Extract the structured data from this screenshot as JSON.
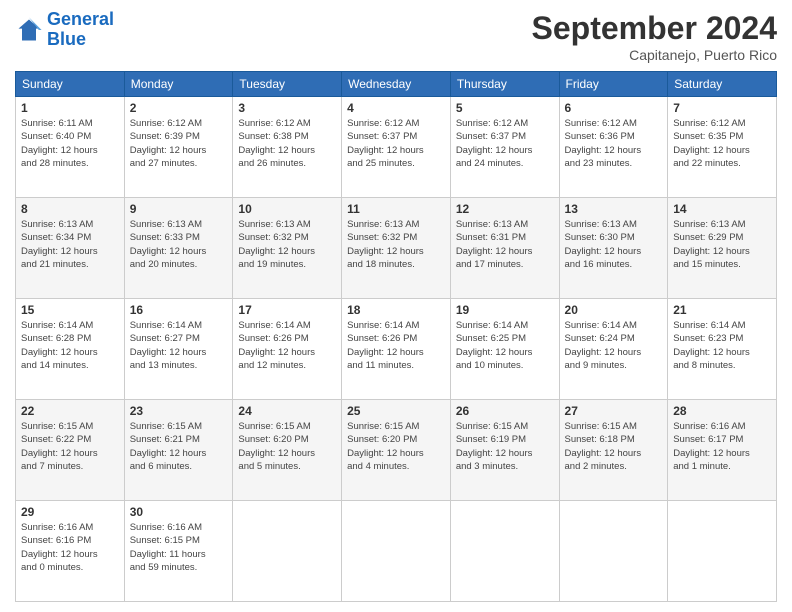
{
  "logo": {
    "line1": "General",
    "line2": "Blue"
  },
  "title": "September 2024",
  "subtitle": "Capitanejo, Puerto Rico",
  "days_header": [
    "Sunday",
    "Monday",
    "Tuesday",
    "Wednesday",
    "Thursday",
    "Friday",
    "Saturday"
  ],
  "weeks": [
    [
      {
        "day": "1",
        "info": "Sunrise: 6:11 AM\nSunset: 6:40 PM\nDaylight: 12 hours\nand 28 minutes."
      },
      {
        "day": "2",
        "info": "Sunrise: 6:12 AM\nSunset: 6:39 PM\nDaylight: 12 hours\nand 27 minutes."
      },
      {
        "day": "3",
        "info": "Sunrise: 6:12 AM\nSunset: 6:38 PM\nDaylight: 12 hours\nand 26 minutes."
      },
      {
        "day": "4",
        "info": "Sunrise: 6:12 AM\nSunset: 6:37 PM\nDaylight: 12 hours\nand 25 minutes."
      },
      {
        "day": "5",
        "info": "Sunrise: 6:12 AM\nSunset: 6:37 PM\nDaylight: 12 hours\nand 24 minutes."
      },
      {
        "day": "6",
        "info": "Sunrise: 6:12 AM\nSunset: 6:36 PM\nDaylight: 12 hours\nand 23 minutes."
      },
      {
        "day": "7",
        "info": "Sunrise: 6:12 AM\nSunset: 6:35 PM\nDaylight: 12 hours\nand 22 minutes."
      }
    ],
    [
      {
        "day": "8",
        "info": "Sunrise: 6:13 AM\nSunset: 6:34 PM\nDaylight: 12 hours\nand 21 minutes."
      },
      {
        "day": "9",
        "info": "Sunrise: 6:13 AM\nSunset: 6:33 PM\nDaylight: 12 hours\nand 20 minutes."
      },
      {
        "day": "10",
        "info": "Sunrise: 6:13 AM\nSunset: 6:32 PM\nDaylight: 12 hours\nand 19 minutes."
      },
      {
        "day": "11",
        "info": "Sunrise: 6:13 AM\nSunset: 6:32 PM\nDaylight: 12 hours\nand 18 minutes."
      },
      {
        "day": "12",
        "info": "Sunrise: 6:13 AM\nSunset: 6:31 PM\nDaylight: 12 hours\nand 17 minutes."
      },
      {
        "day": "13",
        "info": "Sunrise: 6:13 AM\nSunset: 6:30 PM\nDaylight: 12 hours\nand 16 minutes."
      },
      {
        "day": "14",
        "info": "Sunrise: 6:13 AM\nSunset: 6:29 PM\nDaylight: 12 hours\nand 15 minutes."
      }
    ],
    [
      {
        "day": "15",
        "info": "Sunrise: 6:14 AM\nSunset: 6:28 PM\nDaylight: 12 hours\nand 14 minutes."
      },
      {
        "day": "16",
        "info": "Sunrise: 6:14 AM\nSunset: 6:27 PM\nDaylight: 12 hours\nand 13 minutes."
      },
      {
        "day": "17",
        "info": "Sunrise: 6:14 AM\nSunset: 6:26 PM\nDaylight: 12 hours\nand 12 minutes."
      },
      {
        "day": "18",
        "info": "Sunrise: 6:14 AM\nSunset: 6:26 PM\nDaylight: 12 hours\nand 11 minutes."
      },
      {
        "day": "19",
        "info": "Sunrise: 6:14 AM\nSunset: 6:25 PM\nDaylight: 12 hours\nand 10 minutes."
      },
      {
        "day": "20",
        "info": "Sunrise: 6:14 AM\nSunset: 6:24 PM\nDaylight: 12 hours\nand 9 minutes."
      },
      {
        "day": "21",
        "info": "Sunrise: 6:14 AM\nSunset: 6:23 PM\nDaylight: 12 hours\nand 8 minutes."
      }
    ],
    [
      {
        "day": "22",
        "info": "Sunrise: 6:15 AM\nSunset: 6:22 PM\nDaylight: 12 hours\nand 7 minutes."
      },
      {
        "day": "23",
        "info": "Sunrise: 6:15 AM\nSunset: 6:21 PM\nDaylight: 12 hours\nand 6 minutes."
      },
      {
        "day": "24",
        "info": "Sunrise: 6:15 AM\nSunset: 6:20 PM\nDaylight: 12 hours\nand 5 minutes."
      },
      {
        "day": "25",
        "info": "Sunrise: 6:15 AM\nSunset: 6:20 PM\nDaylight: 12 hours\nand 4 minutes."
      },
      {
        "day": "26",
        "info": "Sunrise: 6:15 AM\nSunset: 6:19 PM\nDaylight: 12 hours\nand 3 minutes."
      },
      {
        "day": "27",
        "info": "Sunrise: 6:15 AM\nSunset: 6:18 PM\nDaylight: 12 hours\nand 2 minutes."
      },
      {
        "day": "28",
        "info": "Sunrise: 6:16 AM\nSunset: 6:17 PM\nDaylight: 12 hours\nand 1 minute."
      }
    ],
    [
      {
        "day": "29",
        "info": "Sunrise: 6:16 AM\nSunset: 6:16 PM\nDaylight: 12 hours\nand 0 minutes."
      },
      {
        "day": "30",
        "info": "Sunrise: 6:16 AM\nSunset: 6:15 PM\nDaylight: 11 hours\nand 59 minutes."
      },
      {
        "day": "",
        "info": ""
      },
      {
        "day": "",
        "info": ""
      },
      {
        "day": "",
        "info": ""
      },
      {
        "day": "",
        "info": ""
      },
      {
        "day": "",
        "info": ""
      }
    ]
  ]
}
